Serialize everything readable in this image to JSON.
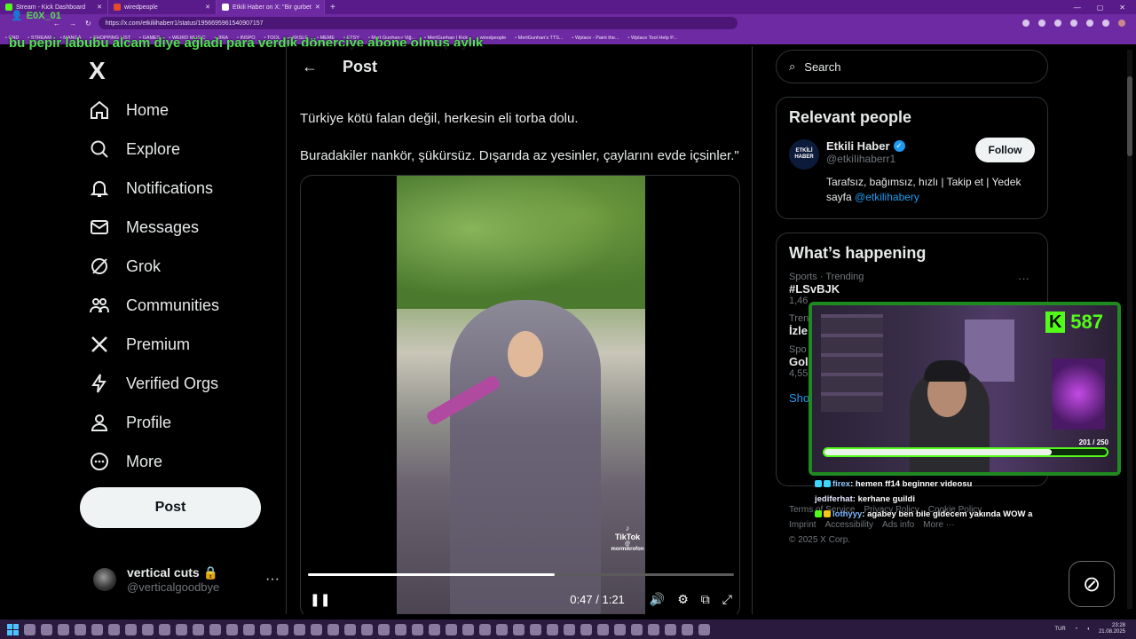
{
  "browser": {
    "tabs": [
      {
        "label": "Stream - Kick Dashboard",
        "color": "#53fc18"
      },
      {
        "label": "wiredpeople",
        "color": "#e44b2a"
      },
      {
        "label": "Etkili Haber on X: \"Bir gurbet",
        "color": "#ffffff"
      }
    ],
    "new_tab": "+",
    "url": "https://x.com/etkiliihaberr1/status/1956695961540907157",
    "bookmarks": [
      "CND",
      "STREAM",
      "MANGA",
      "SHOPPING LIST",
      "GAMES",
      "WEIRD MUSIC",
      "JIRA",
      "INSPO",
      "TOOL",
      "KKSLE",
      "MEME",
      "ETSY",
      "Mert Gunhan-r Viğ...",
      "MertGunhan | Kick",
      "wiredpeople",
      "MertGunhan's TTS...",
      "Wplace - Paint the...",
      "Wplace Tool Help P..."
    ]
  },
  "overlay": {
    "username": "E0X_01",
    "marquee": "bu pepir labubu alcam diye ağladı para verdik dönerciye abone olmuş aylık"
  },
  "nav": {
    "logo": "X",
    "items": [
      {
        "label": "Home",
        "icon": "home-icon"
      },
      {
        "label": "Explore",
        "icon": "search-icon"
      },
      {
        "label": "Notifications",
        "icon": "bell-icon"
      },
      {
        "label": "Messages",
        "icon": "envelope-icon"
      },
      {
        "label": "Grok",
        "icon": "grok-icon"
      },
      {
        "label": "Communities",
        "icon": "people-icon"
      },
      {
        "label": "Premium",
        "icon": "x-icon"
      },
      {
        "label": "Verified Orgs",
        "icon": "lightning-icon"
      },
      {
        "label": "Profile",
        "icon": "person-icon"
      },
      {
        "label": "More",
        "icon": "more-circle-icon"
      }
    ],
    "post_button": "Post",
    "account": {
      "name": "vertical cuts",
      "handle": "@verticalgoodbye",
      "more": "···"
    }
  },
  "post": {
    "header_title": "Post",
    "lines": [
      "Türkiye kötü falan değil, herkesin eli torba dolu.",
      "Buradakiler nankör, şükürsüz. Dışarıda az yesinler, çaylarını evde içsinler.\""
    ],
    "video": {
      "current": "0:47",
      "separator": "/",
      "duration": "1:21",
      "progress": 0.58,
      "watermark": "TikTok",
      "watermark_handle": "@ mormikrofon"
    }
  },
  "right": {
    "search_placeholder": "Search",
    "relevant": {
      "title": "Relevant people",
      "name": "Etkili Haber",
      "handle": "@etkiIihaberr1",
      "follow": "Follow",
      "avatar_text": "ETKİLİ HABER",
      "bio": "Tarafsız, bağımsız, hızlı | Takip et | Yedek sayfa",
      "bio_link": "@etkilihabery"
    },
    "happening": {
      "title": "What’s happening",
      "trends": [
        {
          "meta": "Sports · Trending",
          "title": "#LSvBJK",
          "count": "1,46"
        },
        {
          "meta": "Tren",
          "title": "İzle",
          "count": ""
        },
        {
          "meta": "Spo",
          "title": "Gol",
          "count": "4,55"
        }
      ],
      "show_more": "Sho"
    },
    "footer": [
      "Terms of Service",
      "Privacy Policy",
      "Cookie Policy",
      "Imprint",
      "Accessibility",
      "Ads info",
      "More ···",
      "© 2025 X Corp."
    ]
  },
  "stream": {
    "kick_count": "587",
    "sub_current": "201",
    "sub_goal": "250",
    "sub_sep": "/",
    "chat": [
      {
        "user": "firex",
        "msg": ": hemen ff14 beginner videosu"
      },
      {
        "user": "jediferhat",
        "msg": ": kerhane guildi"
      },
      {
        "user": "lothyyy",
        "msg": ": agabey ben bile gidecem yakında WOW a"
      }
    ]
  },
  "taskbar": {
    "lang": "TUR",
    "time": "23:28",
    "date": "21.08.2025"
  }
}
